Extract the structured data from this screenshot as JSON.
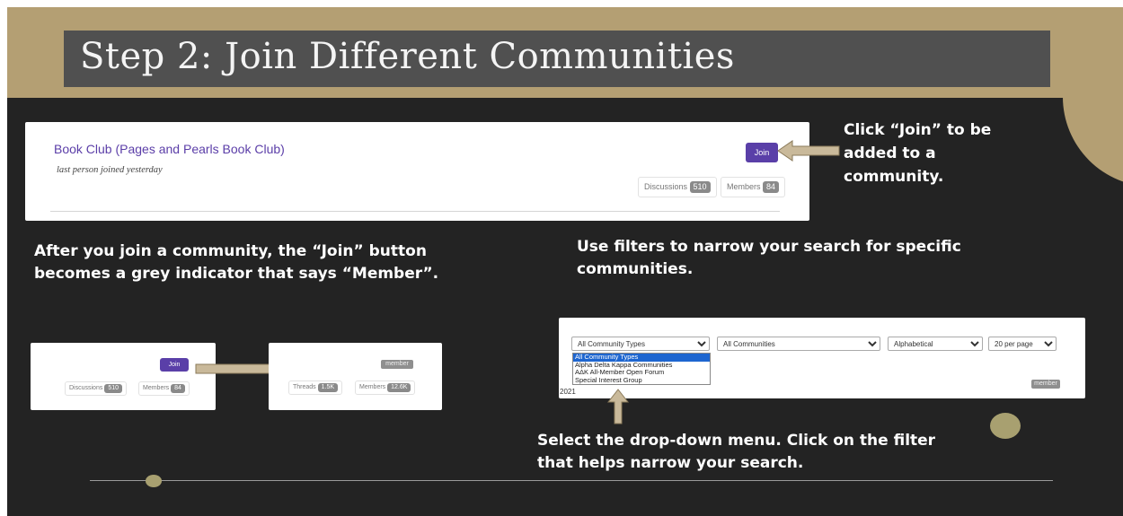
{
  "slide": {
    "title": "Step 2: Join Different Communities",
    "callout_join": "Click “Join” to be added to a community.",
    "callout_member": "After you join a community, the “Join” button becomes a grey indicator that says “Member”.",
    "callout_filters": "Use filters to narrow your search for specific communities.",
    "callout_dropdown": "Select the drop-down menu. Click on the filter that helps narrow your search."
  },
  "community_card": {
    "name": "Book Club (Pages and Pearls Book Club)",
    "subtitle": "last person joined yesterday",
    "join_label": "Join",
    "discussions_label": "Discussions",
    "discussions_count": "510",
    "members_label": "Members",
    "members_count": "84"
  },
  "before_card": {
    "join_label": "Join",
    "discussions_label": "Discussions",
    "discussions_count": "510",
    "members_label": "Members",
    "members_count": "84"
  },
  "after_card": {
    "member_label": "member",
    "threads_label": "Threads",
    "threads_count": "1.5K",
    "members_label": "Members",
    "members_count": "12.6K"
  },
  "filters": {
    "type_selected": "All Community Types",
    "type_options": [
      "All Community Types",
      "Alpha Delta Kappa Communities",
      "AΔK All-Member Open Forum",
      "Special Interest Group"
    ],
    "scope_selected": "All Communities",
    "sort_selected": "Alphabetical",
    "per_page_selected": "20 per page",
    "member_label": "member",
    "year_fragment": "2021"
  },
  "colors": {
    "background": "#232323",
    "gold": "#b49f73",
    "title_box": "#505050",
    "join_purple": "#5a3fa8",
    "link_purple": "#5b3ea8",
    "arrow_tan": "#c9b99a"
  }
}
